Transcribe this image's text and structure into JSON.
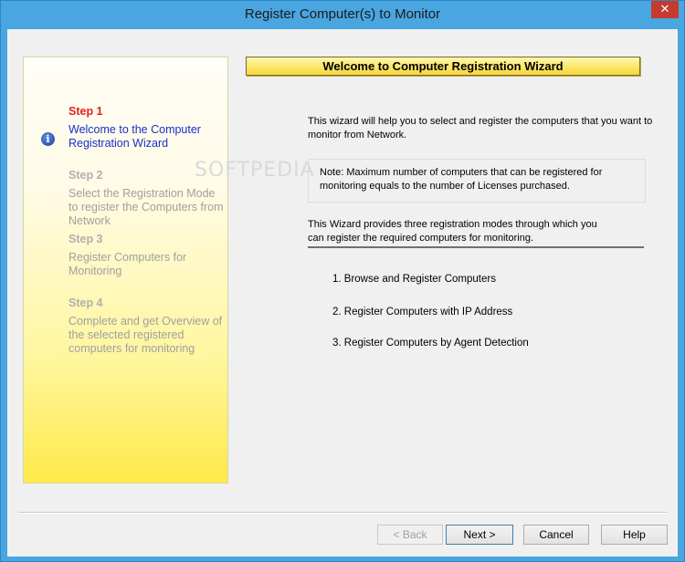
{
  "window": {
    "title": "Register Computer(s) to Monitor",
    "close_glyph": "✕"
  },
  "steps": [
    {
      "title": "Step 1",
      "desc": "Welcome to the Computer Registration Wizard",
      "active": true
    },
    {
      "title": "Step 2",
      "desc": "Select the Registration Mode to register the Computers from Network",
      "active": false
    },
    {
      "title": "Step 3",
      "desc": "Register Computers for Monitoring",
      "active": false
    },
    {
      "title": "Step 4",
      "desc": "Complete and get Overview of the selected registered computers for monitoring",
      "active": false
    }
  ],
  "watermark": "SOFTPEDIA",
  "content": {
    "banner": "Welcome to Computer Registration Wizard",
    "intro": "This wizard will help you to select and register the computers that you want to monitor from Network.",
    "note": "Note: Maximum number of computers that can be registered for monitoring equals to the number of Licenses purchased.",
    "modes_intro": "This Wizard provides three registration modes through which you can register the required computers for monitoring.",
    "modes": [
      "1.  Browse and Register Computers",
      "2.  Register Computers with IP Address",
      "3.  Register Computers by Agent Detection"
    ]
  },
  "buttons": {
    "back": "< Back",
    "next": "Next >",
    "cancel": "Cancel",
    "help": "Help"
  },
  "colors": {
    "title_bar": "#4aa6e0",
    "close_button": "#c73a2e",
    "active_step_title": "#e11f1f",
    "active_step_desc": "#1a2fc8",
    "inactive_step": "#a0a0a0",
    "banner_fill": "#fce86e"
  },
  "icons": {
    "current_step": "info-icon"
  }
}
